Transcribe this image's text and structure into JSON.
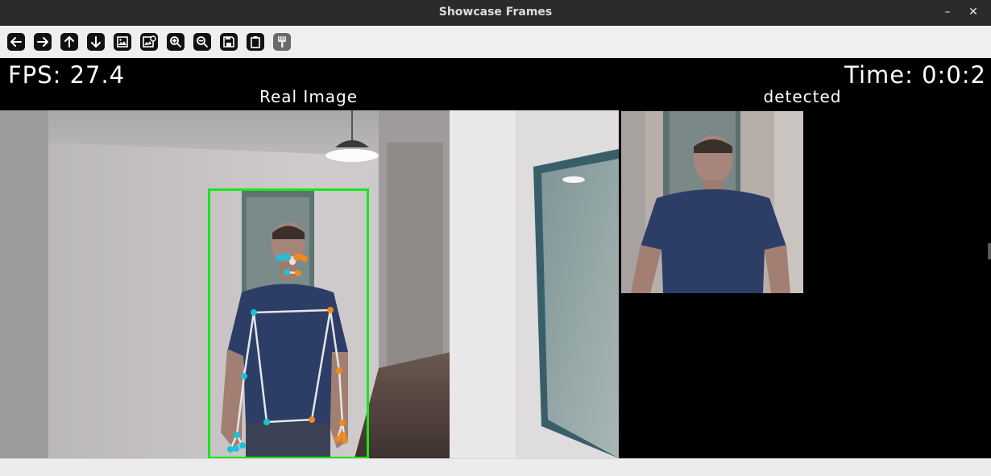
{
  "window": {
    "title": "Showcase Frames",
    "minimize_glyph": "–",
    "close_glyph": "✕"
  },
  "toolbar": {
    "buttons": [
      {
        "icon": "arrow-left-icon"
      },
      {
        "icon": "arrow-right-icon"
      },
      {
        "icon": "arrow-up-icon"
      },
      {
        "icon": "arrow-down-icon"
      },
      {
        "icon": "image-icon"
      },
      {
        "icon": "image-settings-icon"
      },
      {
        "icon": "zoom-in-icon"
      },
      {
        "icon": "zoom-out-icon"
      },
      {
        "icon": "save-icon"
      },
      {
        "icon": "clipboard-icon"
      },
      {
        "icon": "paint-brush-icon"
      }
    ]
  },
  "overlay": {
    "fps": "FPS: 27.4",
    "time": "Time: 0:0:2",
    "real_label": "Real Image",
    "detected_label": "detected"
  },
  "colors": {
    "bbox": "#19e619",
    "skeleton": "#e6e6e6",
    "left_joint": "#1ec2d8",
    "right_joint": "#f08a1c",
    "shirt": "#2c3e66"
  }
}
